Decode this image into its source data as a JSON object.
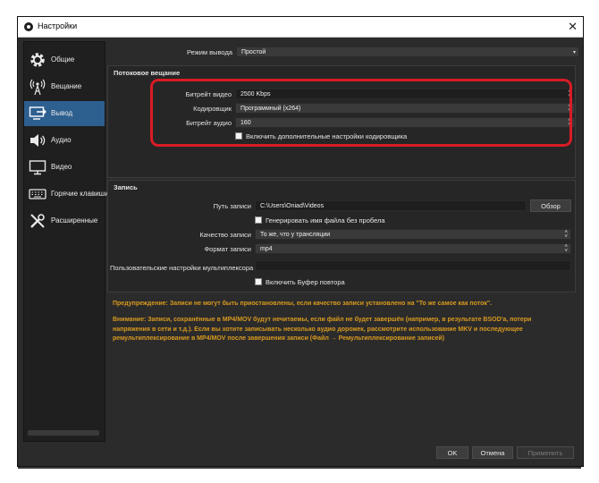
{
  "window": {
    "title": "Настройки",
    "close": "✕"
  },
  "sidebar": {
    "items": [
      {
        "label": "Общие",
        "icon": "gear-icon"
      },
      {
        "label": "Вещание",
        "icon": "broadcast-icon"
      },
      {
        "label": "Вывод",
        "icon": "output-icon"
      },
      {
        "label": "Аудио",
        "icon": "speaker-icon"
      },
      {
        "label": "Видео",
        "icon": "monitor-icon"
      },
      {
        "label": "Горячие клавиши",
        "icon": "keyboard-icon"
      },
      {
        "label": "Расширенные",
        "icon": "tools-icon"
      }
    ],
    "active_index": 2
  },
  "output_mode": {
    "label": "Режим вывода",
    "value": "Простой"
  },
  "streaming": {
    "title": "Потоковое вещание",
    "video_bitrate": {
      "label": "Битрейт видео",
      "value": "2500 Kbps"
    },
    "encoder": {
      "label": "Кодировщик",
      "value": "Программный (x264)"
    },
    "audio_bitrate": {
      "label": "Битрейт аудио",
      "value": "160"
    },
    "advanced_checkbox": {
      "label": "Включить дополнительные настройки кодировщика",
      "checked": false
    }
  },
  "recording": {
    "title": "Запись",
    "path": {
      "label": "Путь записи",
      "value": "C:\\Users\\Oniad\\Videos",
      "browse": "Обзор"
    },
    "no_space_checkbox": {
      "label": "Генерировать имя файла без пробела",
      "checked": false
    },
    "quality": {
      "label": "Качество записи",
      "value": "То же, что у трансляции"
    },
    "format": {
      "label": "Формат записи",
      "value": "mp4"
    },
    "muxer": {
      "label": "Пользовательские настройки мультиплексора",
      "value": ""
    },
    "replay_checkbox": {
      "label": "Включить Буфер повтора",
      "checked": false
    }
  },
  "warnings": {
    "w1": "Предупреждение: Записи не могут быть приостановлены, если качество записи установлено на \"То же самое как поток\".",
    "w2_line1": "Внимание: Записи, сохранённые в MP4/MOV будут нечитаемы, если файл не будет завершён (например, в результате BSOD'а, потери",
    "w2_line2": "напряжения в сети и т.д.). Если вы хотите записывать несколько аудио дорожек, рассмотрите использование MKV и последующее",
    "w2_line3": "ремультиплексирование в MP4/MOV после завершения записи (Файл → Ремультиплексирование записей)"
  },
  "footer": {
    "ok": "OK",
    "cancel": "Отмена",
    "apply": "Применить"
  }
}
